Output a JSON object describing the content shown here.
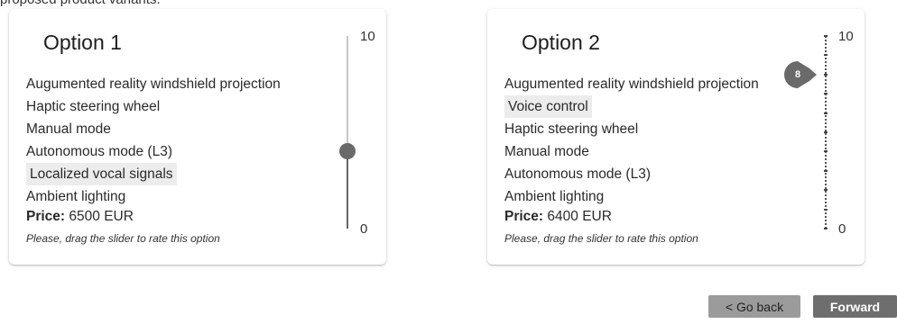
{
  "intro_text": "proposed product variants.",
  "options": [
    {
      "title": "Option 1",
      "features": [
        {
          "label": "Augumented reality windshield projection",
          "highlighted": false
        },
        {
          "label": "Haptic steering wheel",
          "highlighted": false
        },
        {
          "label": "Manual mode",
          "highlighted": false
        },
        {
          "label": "Autonomous mode (L3)",
          "highlighted": false
        },
        {
          "label": "Localized vocal signals",
          "highlighted": true
        },
        {
          "label": "Ambient lighting",
          "highlighted": false
        }
      ],
      "price_label": "Price:",
      "price_value": "6500 EUR",
      "hint": "Please, drag the slider to rate this option",
      "slider": {
        "max_label": "10",
        "min_label": "0",
        "min": 0,
        "max": 10,
        "value": 4,
        "show_value_label": false
      }
    },
    {
      "title": "Option 2",
      "features": [
        {
          "label": "Augumented reality windshield projection",
          "highlighted": false
        },
        {
          "label": "Voice control",
          "highlighted": true
        },
        {
          "label": "Haptic steering wheel",
          "highlighted": false
        },
        {
          "label": "Manual mode",
          "highlighted": false
        },
        {
          "label": "Autonomous mode (L3)",
          "highlighted": false
        },
        {
          "label": "Ambient lighting",
          "highlighted": false
        }
      ],
      "price_label": "Price:",
      "price_value": "6400 EUR",
      "hint": "Please, drag the slider to rate this option",
      "slider": {
        "max_label": "10",
        "min_label": "0",
        "min": 0,
        "max": 10,
        "value": 8,
        "value_label": "8",
        "show_value_label": true
      }
    }
  ],
  "buttons": {
    "back_label": "< Go back",
    "forward_label": "Forward"
  },
  "colors": {
    "highlight_bg": "#ececec",
    "slider_thumb": "#6a6a6a",
    "back_button": "#9b9b9b",
    "forward_button": "#6e6e6e"
  },
  "icons": {
    "slider_thumb": "circle-thumb",
    "value_label": "teardrop-value-label"
  }
}
